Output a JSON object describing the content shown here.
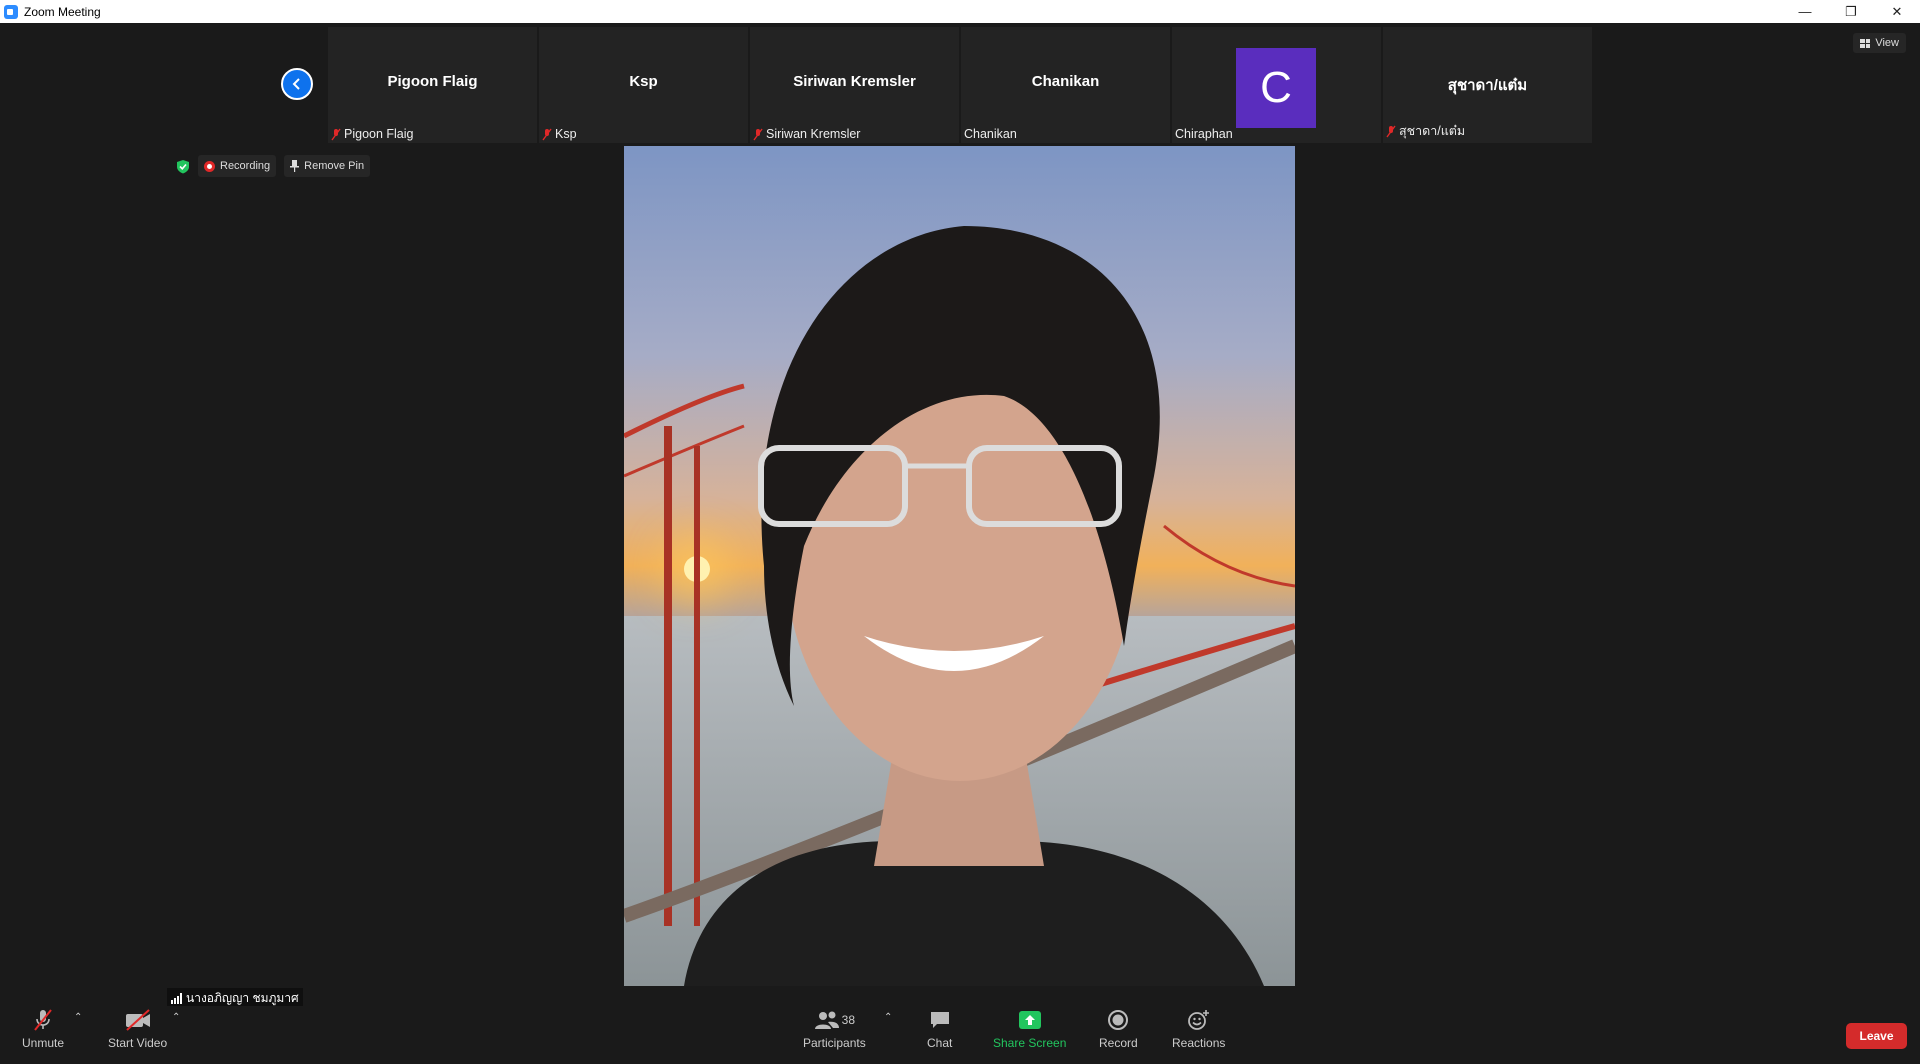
{
  "window": {
    "title": "Zoom Meeting"
  },
  "view_button": {
    "label": "View"
  },
  "participants_strip": [
    {
      "big_name": "Pigoon Flaig",
      "small_name": "Pigoon Flaig",
      "muted": true
    },
    {
      "big_name": "Ksp",
      "small_name": "Ksp",
      "muted": true
    },
    {
      "big_name": "Siriwan Kremsler",
      "small_name": "Siriwan Kremsler",
      "muted": true
    },
    {
      "big_name": "Chanikan",
      "small_name": "Chanikan",
      "muted": false
    },
    {
      "avatar_letter": "C",
      "small_name": "Chiraphan",
      "muted": false
    },
    {
      "big_name": "สุชาดา/แต๋ม",
      "small_name": "สุชาดา/แต๋ม",
      "muted": true
    }
  ],
  "status": {
    "recording": "Recording",
    "remove_pin": "Remove Pin"
  },
  "self_view": {
    "name": "นางอภิญญา ชมภูมาศ"
  },
  "toolbar": {
    "unmute": "Unmute",
    "start_video": "Start Video",
    "participants": "Participants",
    "participants_count": "38",
    "chat": "Chat",
    "share_screen": "Share Screen",
    "record": "Record",
    "reactions": "Reactions",
    "leave": "Leave"
  },
  "colors": {
    "accent": "#0e72ed",
    "share_green": "#22c55e",
    "leave_red": "#d42b2b",
    "avatar_purple": "#5a2dbe"
  }
}
